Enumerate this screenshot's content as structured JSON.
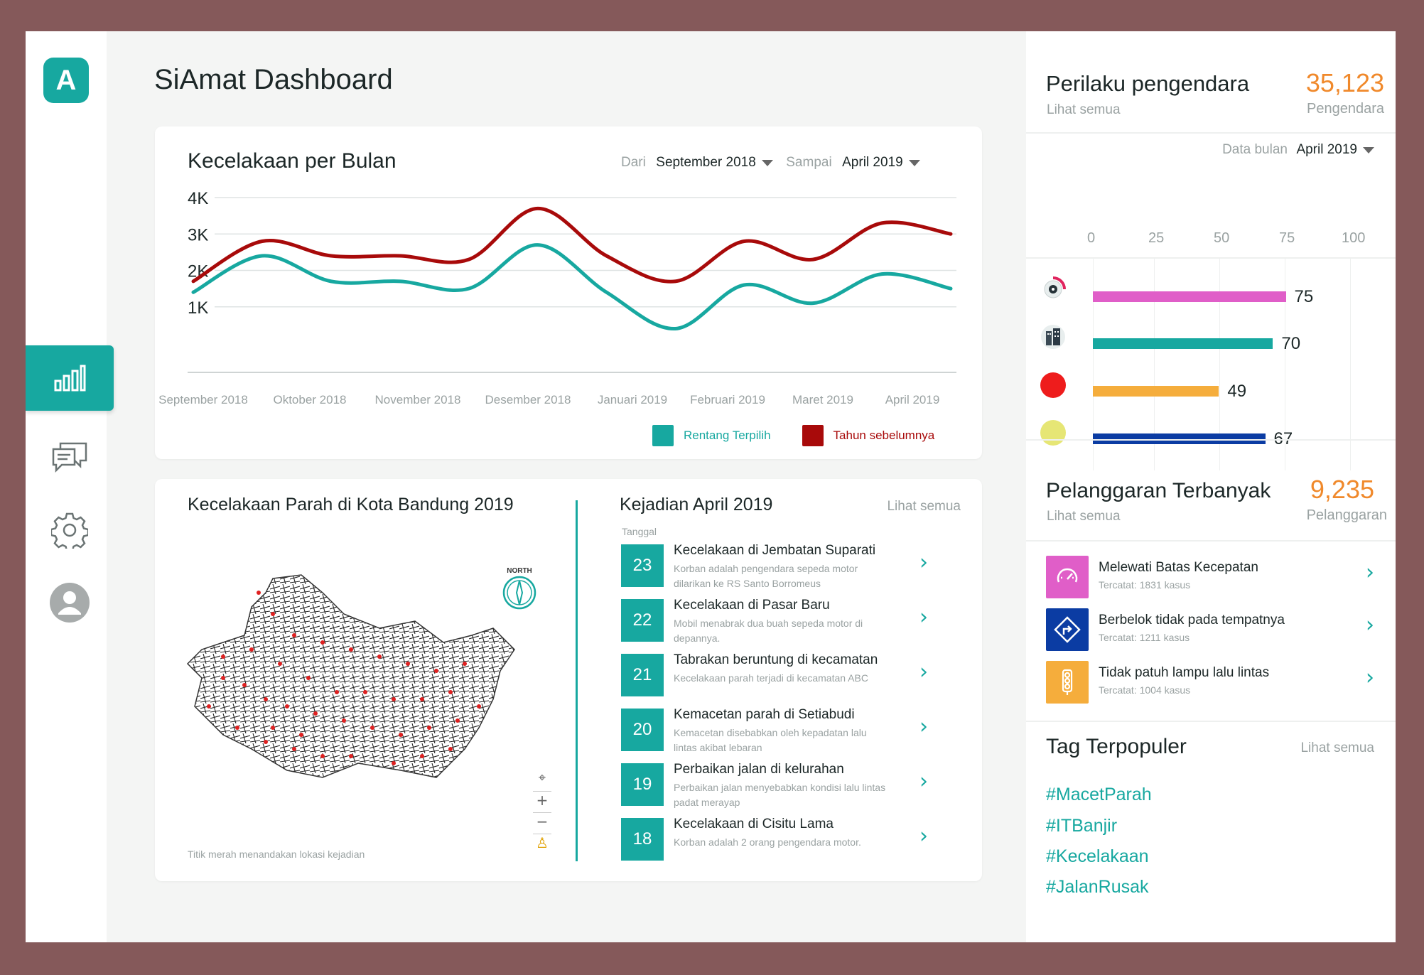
{
  "app": {
    "title": "SiAmat Dashboard",
    "logo_letter": "A"
  },
  "sidebar": {
    "items": [
      {
        "name": "dashboard",
        "icon": "bar-chart-icon",
        "active": true
      },
      {
        "name": "messages",
        "icon": "chat-icon",
        "active": false
      },
      {
        "name": "settings",
        "icon": "gear-icon",
        "active": false
      },
      {
        "name": "profile",
        "icon": "user-avatar-icon",
        "active": false
      }
    ]
  },
  "monthly": {
    "title": "Kecelakaan per Bulan",
    "from_label": "Dari",
    "from_value": "September 2018",
    "to_label": "Sampai",
    "to_value": "April 2019",
    "legend": {
      "current": "Rentang Terpilih",
      "previous": "Tahun sebelumnya"
    }
  },
  "chart_data": {
    "type": "line",
    "x": [
      "September 2018",
      "Oktober 2018",
      "November 2018",
      "Desember 2018",
      "Januari 2019",
      "Februari 2019",
      "Maret 2019",
      "April 2019"
    ],
    "y_ticks": [
      "4K",
      "3K",
      "2K",
      "1K"
    ],
    "ylim": [
      0,
      4000
    ],
    "series": [
      {
        "name": "Rentang Terpilih",
        "color": "#17a8a0",
        "values": [
          1400,
          2400,
          1700,
          1700,
          1500,
          2700,
          1400,
          400,
          1600,
          1100,
          1900,
          1500
        ]
      },
      {
        "name": "Tahun sebelumnya",
        "color": "#a80a0a",
        "values": [
          1700,
          2800,
          2400,
          2400,
          2300,
          3700,
          2400,
          1700,
          2800,
          2300,
          3300,
          3000
        ]
      }
    ],
    "grid": true,
    "legend_position": "bottom-right"
  },
  "map": {
    "title": "Kecelakaan Parah di Kota Bandung 2019",
    "north_label": "NORTH",
    "caption": "Titik merah menandakan lokasi kejadian",
    "controls": {
      "locate": "⌖",
      "zoom_in": "+",
      "zoom_out": "−",
      "person": "♙"
    }
  },
  "events": {
    "title": "Kejadian April 2019",
    "see_all": "Lihat semua",
    "date_label": "Tanggal",
    "items": [
      {
        "day": "23",
        "title": "Kecelakaan di Jembatan Suparati",
        "desc": "Korban adalah pengendara sepeda motor dilarikan ke RS Santo Borromeus"
      },
      {
        "day": "22",
        "title": "Kecelakaan di Pasar Baru",
        "desc": "Mobil menabrak dua buah sepeda motor di depannya."
      },
      {
        "day": "21",
        "title": "Tabrakan beruntung di kecamatan",
        "desc": "Kecelakaan parah terjadi di kecamatan ABC"
      },
      {
        "day": "20",
        "title": "Kemacetan parah di Setiabudi",
        "desc": "Kemacetan disebabkan oleh kepadatan lalu lintas akibat lebaran"
      },
      {
        "day": "19",
        "title": "Perbaikan jalan di kelurahan",
        "desc": "Perbaikan jalan menyebabkan kondisi lalu lintas padat merayap"
      },
      {
        "day": "18",
        "title": "Kecelakaan di Cisitu Lama",
        "desc": "Korban adalah 2 orang pengendara motor."
      }
    ]
  },
  "riders": {
    "title": "Perilaku pengendara",
    "see_all": "Lihat semua",
    "count": "35,123",
    "count_label": "Pengendara",
    "month_label": "Data bulan",
    "month_value": "April 2019",
    "axis_ticks": [
      "0",
      "25",
      "50",
      "75",
      "100"
    ],
    "bars": [
      {
        "icon": "speedometer-icon",
        "value": 75,
        "label": "75",
        "color": "#e05ec8"
      },
      {
        "icon": "building-icon",
        "value": 70,
        "label": "70",
        "color": "#17a8a0"
      },
      {
        "icon": "red-dot-icon",
        "value": 49,
        "label": "49",
        "color": "#f5ad3c"
      },
      {
        "icon": "yellow-dot-icon",
        "value": 67,
        "label": "67",
        "color": "#0b3ca3"
      }
    ]
  },
  "violations": {
    "title": "Pelanggaran Terbanyak",
    "see_all": "Lihat semua",
    "count": "9,235",
    "count_label": "Pelanggaran",
    "items": [
      {
        "title": "Melewati Batas Kecepatan",
        "sub": "Tercatat: 1831 kasus",
        "color": "#e05ec8",
        "icon": "speedometer-icon"
      },
      {
        "title": "Berbelok tidak pada tempatnya",
        "sub": "Tercatat: 1211 kasus",
        "color": "#0b3ca3",
        "icon": "turn-sign-icon"
      },
      {
        "title": "Tidak patuh lampu lalu lintas",
        "sub": "Tercatat: 1004 kasus",
        "color": "#f5ad3c",
        "icon": "traffic-light-icon"
      }
    ]
  },
  "tags": {
    "title": "Tag Terpopuler",
    "see_all": "Lihat semua",
    "items": [
      "#MacetParah",
      "#ITBanjir",
      "#Kecelakaan",
      "#JalanRusak"
    ]
  },
  "colors": {
    "accent": "#17a8a0",
    "previous": "#a80a0a",
    "highlight": "#f0892b"
  }
}
